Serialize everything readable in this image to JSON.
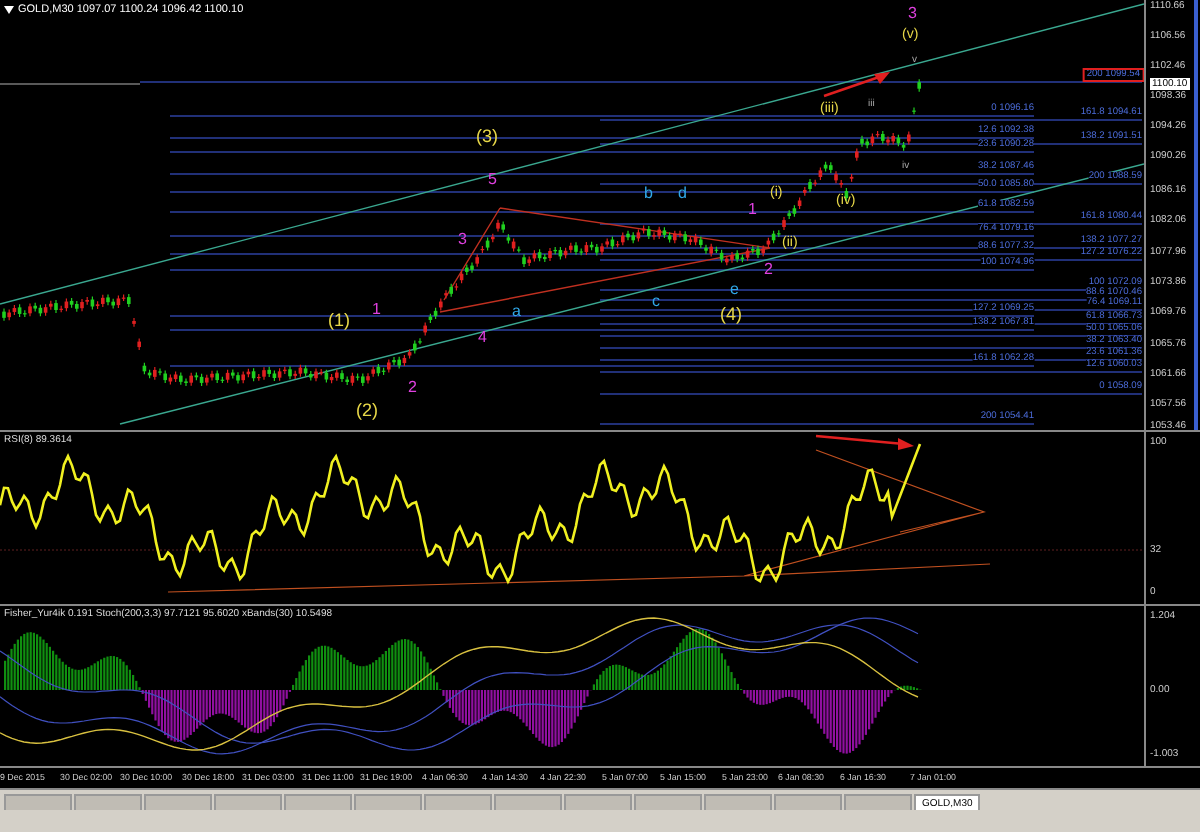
{
  "header": {
    "text": "GOLD,M30  1097.07 1100.24 1096.42 1100.10"
  },
  "price_axis": [
    {
      "label": "1110.66",
      "current": false
    },
    {
      "label": "1106.56",
      "current": false
    },
    {
      "label": "1102.46",
      "current": false
    },
    {
      "label": "1100.10",
      "current": true
    },
    {
      "label": "1098.36",
      "current": false
    },
    {
      "label": "1094.26",
      "current": false
    },
    {
      "label": "1090.26",
      "current": false
    },
    {
      "label": "1086.16",
      "current": false
    },
    {
      "label": "1082.06",
      "current": false
    },
    {
      "label": "1077.96",
      "current": false
    },
    {
      "label": "1073.86",
      "current": false
    },
    {
      "label": "1069.76",
      "current": false
    },
    {
      "label": "1065.76",
      "current": false
    },
    {
      "label": "1061.66",
      "current": false
    },
    {
      "label": "1057.56",
      "current": false
    },
    {
      "label": "1053.46",
      "current": false
    }
  ],
  "fib_labels": [
    {
      "text": "200 1099.54",
      "boxed": true
    },
    {
      "text": "0 1096.16",
      "boxed": false
    },
    {
      "text": "161.8 1094.61",
      "boxed": false
    },
    {
      "text": "12.6 1092.38",
      "boxed": false
    },
    {
      "text": "138.2 1091.51",
      "boxed": false
    },
    {
      "text": "23.6 1090.28",
      "boxed": false
    },
    {
      "text": "38.2 1087.46",
      "boxed": false
    },
    {
      "text": "200 1088.59",
      "boxed": false
    },
    {
      "text": "50.0 1085.80",
      "boxed": false
    },
    {
      "text": "61.8 1082.59",
      "boxed": false
    },
    {
      "text": "161.8 1080.44",
      "boxed": false
    },
    {
      "text": "76.4 1079.16",
      "boxed": false
    },
    {
      "text": "138.2 1077.27",
      "boxed": false
    },
    {
      "text": "88.6 1077.32",
      "boxed": false
    },
    {
      "text": "127.2 1076.22",
      "boxed": false
    },
    {
      "text": "100 1074.96",
      "boxed": false
    },
    {
      "text": "100 1072.09",
      "boxed": false
    },
    {
      "text": "88.6 1070.46",
      "boxed": false
    },
    {
      "text": "76.4 1069.11",
      "boxed": false
    },
    {
      "text": "127.2 1069.25",
      "boxed": false
    },
    {
      "text": "61.8 1066.73",
      "boxed": false
    },
    {
      "text": "138.2 1067.81",
      "boxed": false
    },
    {
      "text": "50.0 1065.06",
      "boxed": false
    },
    {
      "text": "38.2 1063.40",
      "boxed": false
    },
    {
      "text": "23.6 1061.36",
      "boxed": false
    },
    {
      "text": "161.8 1062.28",
      "boxed": false
    },
    {
      "text": "12.6 1060.03",
      "boxed": false
    },
    {
      "text": "0 1058.09",
      "boxed": false
    },
    {
      "text": "200 1054.41",
      "boxed": false
    }
  ],
  "wave_labels": [
    {
      "text": "(3)",
      "kind": "primary"
    },
    {
      "text": "5",
      "kind": "minor"
    },
    {
      "text": "3",
      "kind": "minor"
    },
    {
      "text": "b",
      "kind": "corrective"
    },
    {
      "text": "d",
      "kind": "corrective"
    },
    {
      "text": "a",
      "kind": "corrective"
    },
    {
      "text": "c",
      "kind": "corrective"
    },
    {
      "text": "e",
      "kind": "corrective"
    },
    {
      "text": "4",
      "kind": "minor"
    },
    {
      "text": "(1)",
      "kind": "primary"
    },
    {
      "text": "1",
      "kind": "minor"
    },
    {
      "text": "(2)",
      "kind": "primary"
    },
    {
      "text": "2",
      "kind": "minor"
    },
    {
      "text": "(4)",
      "kind": "primary"
    },
    {
      "text": "1",
      "kind": "minor"
    },
    {
      "text": "2",
      "kind": "minor"
    },
    {
      "text": "(i)",
      "kind": "sub"
    },
    {
      "text": "(ii)",
      "kind": "sub"
    },
    {
      "text": "(iii)",
      "kind": "sub"
    },
    {
      "text": "(iv)",
      "kind": "sub"
    },
    {
      "text": "3",
      "kind": "minor"
    },
    {
      "text": "(v)",
      "kind": "sub"
    },
    {
      "text": "iii",
      "kind": "tiny"
    },
    {
      "text": "iv",
      "kind": "tiny"
    },
    {
      "text": "v",
      "kind": "tiny"
    }
  ],
  "rsi": {
    "title": "RSI(8) 89.3614",
    "axis": [
      "100",
      "32",
      "0"
    ]
  },
  "fisher": {
    "title": "Fisher_Yur4ik 0.191  Stoch(200,3,3) 97.7121 95.6020  xBands(30) 10.5498",
    "axis": [
      "1.204",
      "0.00",
      "-1.003"
    ]
  },
  "time_axis": [
    "9 Dec 2015",
    "30 Dec 02:00",
    "30 Dec 10:00",
    "30 Dec 18:00",
    "31 Dec 03:00",
    "31 Dec 11:00",
    "31 Dec 19:00",
    "4 Jan 06:30",
    "4 Jan 14:30",
    "4 Jan 22:30",
    "5 Jan 07:00",
    "5 Jan 15:00",
    "5 Jan 23:00",
    "6 Jan 08:30",
    "6 Jan 16:30",
    "7 Jan 01:00"
  ],
  "tabs": [
    {
      "label": "GOLD,M30",
      "selected": true
    }
  ]
}
